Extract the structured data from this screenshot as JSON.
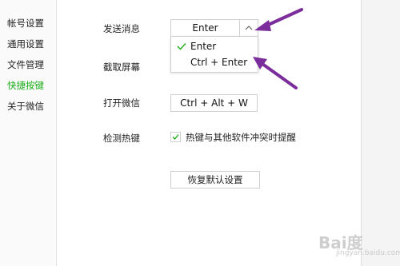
{
  "sidebar": {
    "items": [
      {
        "label": "帐号设置"
      },
      {
        "label": "通用设置"
      },
      {
        "label": "文件管理"
      },
      {
        "label": "快捷按键",
        "active": true
      },
      {
        "label": "关于微信"
      }
    ]
  },
  "settings": {
    "send_message": {
      "label": "发送消息",
      "selected": "Enter",
      "options": [
        {
          "label": "Enter",
          "checked": true
        },
        {
          "label": "Ctrl + Enter",
          "checked": false
        }
      ]
    },
    "screenshot": {
      "label": "截取屏幕"
    },
    "open_wechat": {
      "label": "打开微信",
      "value": "Ctrl + Alt + W"
    },
    "detect_hotkey": {
      "label": "检测热键",
      "checkbox_label": "热键与其他软件冲突时提醒",
      "checked": true
    },
    "restore_button": "恢复默认设置"
  },
  "watermark": {
    "main": "Bai度",
    "sub": "jingyan.baidu.com"
  },
  "colors": {
    "accent": "#1aad19",
    "annotation_arrow": "#7b2d9b"
  },
  "icons": {
    "combo_arrow": "chevron-up-icon",
    "check": "checkmark-icon",
    "annotation": "arrow-annotation-icon"
  }
}
